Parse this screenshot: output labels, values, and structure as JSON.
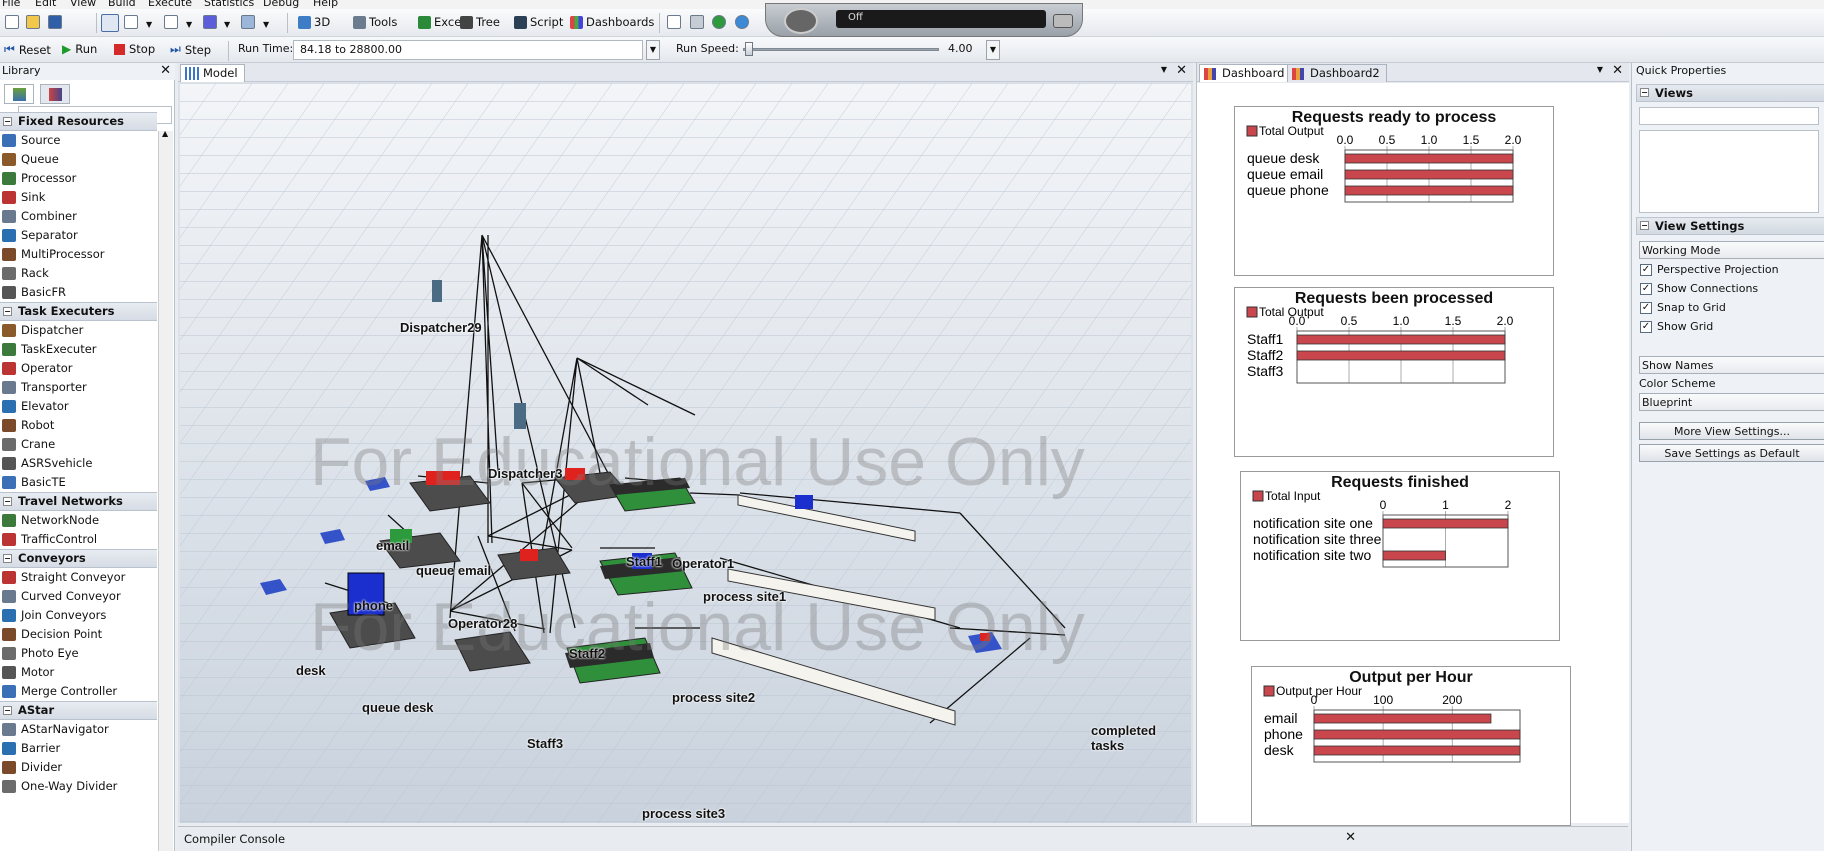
{
  "menu": [
    "File",
    "Edit",
    "View",
    "Build",
    "Execute",
    "Statistics",
    "Debug",
    "Help"
  ],
  "toolbar": {
    "view3d": "3D",
    "tools": "Tools",
    "excel": "Excel",
    "tree": "Tree",
    "script": "Script",
    "dashboards": "Dashboards",
    "gauge_text": "Off"
  },
  "runbar": {
    "reset": "Reset",
    "run": "Run",
    "stop": "Stop",
    "step": "Step",
    "run_time_label": "Run Time:",
    "run_time_value": "84.18  to  28800.00",
    "run_speed_label": "Run Speed:",
    "run_speed_value": "4.00",
    "run_speed_fraction": 0.03
  },
  "library": {
    "title": "Library",
    "categories": [
      {
        "label": "Fixed Resources",
        "items": [
          "Source",
          "Queue",
          "Processor",
          "Sink",
          "Combiner",
          "Separator",
          "MultiProcessor",
          "Rack",
          "BasicFR"
        ]
      },
      {
        "label": "Task Executers",
        "items": [
          "Dispatcher",
          "TaskExecuter",
          "Operator",
          "Transporter",
          "Elevator",
          "Robot",
          "Crane",
          "ASRSvehicle",
          "BasicTE"
        ]
      },
      {
        "label": "Travel Networks",
        "items": [
          "NetworkNode",
          "TrafficControl"
        ]
      },
      {
        "label": "Conveyors",
        "items": [
          "Straight Conveyor",
          "Curved Conveyor",
          "Join Conveyors",
          "Decision Point",
          "Photo Eye",
          "Motor",
          "Merge Controller"
        ]
      },
      {
        "label": "AStar",
        "items": [
          "AStarNavigator",
          "Barrier",
          "Divider",
          "One-Way Divider"
        ]
      }
    ]
  },
  "model": {
    "tab": "Model",
    "watermark": "For Educational Use Only",
    "labels": {
      "dispatcher29": "Dispatcher29",
      "dispatcher3": "Dispatcher3",
      "email": "email",
      "queue_email": "queue email",
      "staff1": "Staff1",
      "operator1": "Operator1",
      "process_site1": "process site1",
      "phone": "phone",
      "operator28": "Operator28",
      "staff2": "Staff2",
      "desk": "desk",
      "queue_desk": "queue desk",
      "process_site2": "process site2",
      "staff3": "Staff3",
      "process_site3": "process site3",
      "completed_tasks": "completed tasks"
    }
  },
  "dashboard": {
    "tabs": [
      "Dashboard",
      "Dashboard2"
    ],
    "bar_color": "#c8464c"
  },
  "chart_data": [
    {
      "type": "bar",
      "title": "Requests ready to process",
      "legend": [
        "Total Output"
      ],
      "categories": [
        "queue desk",
        "queue email",
        "queue phone"
      ],
      "values": [
        2,
        2,
        2
      ],
      "xlim": [
        0,
        2
      ],
      "ticks": [
        "0.0",
        "0.5",
        "1.0",
        "1.5",
        "2.0"
      ]
    },
    {
      "type": "bar",
      "title": "Requests been processed",
      "legend": [
        "Total Output"
      ],
      "categories": [
        "Staff1",
        "Staff2",
        "Staff3"
      ],
      "values": [
        2,
        2,
        0
      ],
      "xlim": [
        0,
        2
      ],
      "ticks": [
        "0.0",
        "0.5",
        "1.0",
        "1.5",
        "2.0"
      ]
    },
    {
      "type": "bar",
      "title": "Requests finished",
      "legend": [
        "Total Input"
      ],
      "categories": [
        "notification site one",
        "notification site three",
        "notification site two"
      ],
      "values": [
        2,
        0,
        1
      ],
      "xlim": [
        0,
        2
      ],
      "ticks": [
        "0",
        "1",
        "2"
      ]
    },
    {
      "type": "bar",
      "title": "Output per Hour",
      "legend": [
        "Output per Hour"
      ],
      "categories": [
        "email",
        "phone",
        "desk"
      ],
      "values": [
        256,
        298,
        298
      ],
      "xlim": [
        0,
        298
      ],
      "ticks": [
        "0",
        "100",
        "200"
      ]
    }
  ],
  "quick_properties": {
    "title": "Quick Properties",
    "views_section": "Views",
    "view_settings_section": "View Settings",
    "working_mode": "Working Mode",
    "checkboxes": [
      {
        "label": "Perspective Projection",
        "checked": true
      },
      {
        "label": "Show Connections",
        "checked": true
      },
      {
        "label": "Snap to Grid",
        "checked": true
      },
      {
        "label": "Show Grid",
        "checked": true
      }
    ],
    "show_names": "Show Names",
    "color_scheme_label": "Color Scheme",
    "color_scheme_value": "Blueprint",
    "more_button": "More View Settings...",
    "save_button": "Save Settings as Default"
  },
  "console": {
    "title": "Compiler Console"
  }
}
